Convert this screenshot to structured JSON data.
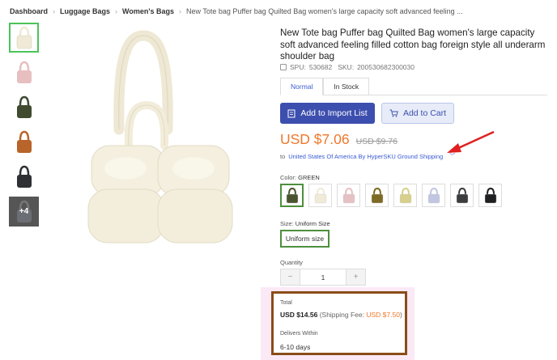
{
  "breadcrumb": [
    "Dashboard",
    "Luggage Bags",
    "Women's Bags",
    "New Tote bag Puffer bag Quilted Bag women's large capacity soft advanced feeling ..."
  ],
  "thumbnails": [
    {
      "color": "#efe9d6",
      "more": ""
    },
    {
      "color": "#e7bfc0",
      "more": ""
    },
    {
      "color": "#3f4a2f",
      "more": ""
    },
    {
      "color": "#b8642a",
      "more": ""
    },
    {
      "color": "#2f3033",
      "more": ""
    },
    {
      "color": "#5a5c62",
      "more": "+4"
    }
  ],
  "product": {
    "title": "New Tote bag Puffer bag Quilted Bag women's large capacity soft advanced feeling filled cotton bag foreign style all underarm shoulder bag",
    "spu_label": "SPU:",
    "spu": "530682",
    "sku_label": "SKU:",
    "sku": "200530682300030"
  },
  "tabs": [
    "Normal",
    "In Stock"
  ],
  "buttons": {
    "import": "Add to Import List",
    "cart": "Add to Cart"
  },
  "price": {
    "current": "USD $7.06",
    "original": "USD $9.76"
  },
  "shipping": {
    "to": "to",
    "destination": "United States Of America By HyperSKU Ground Shipping"
  },
  "color": {
    "label": "Color:",
    "value": "GREEN"
  },
  "swatches": [
    "#4a5530",
    "#f0ead8",
    "#e6c1c4",
    "#7d6a24",
    "#d6d08c",
    "#c1c6e2",
    "#3b3d40",
    "#1f2022"
  ],
  "size": {
    "label": "Size:",
    "value": "Uniform Size",
    "option": "Uniform size"
  },
  "quantity": {
    "label": "Quantity",
    "minus": "−",
    "value": "1",
    "plus": "+"
  },
  "total": {
    "label": "Total",
    "amount": "USD $14.56",
    "fee_prefix": "(Shipping Fee:",
    "fee_value": "USD $7.50",
    "fee_suffix": ")",
    "deliver_label": "Delivers Within",
    "deliver_value": "6-10 days"
  },
  "colors": {
    "accent": "#3d4fae",
    "price": "#f0782a",
    "selected": "#4d8f3e",
    "highlight_border": "#8a4d18",
    "arrow": "#e02020"
  }
}
